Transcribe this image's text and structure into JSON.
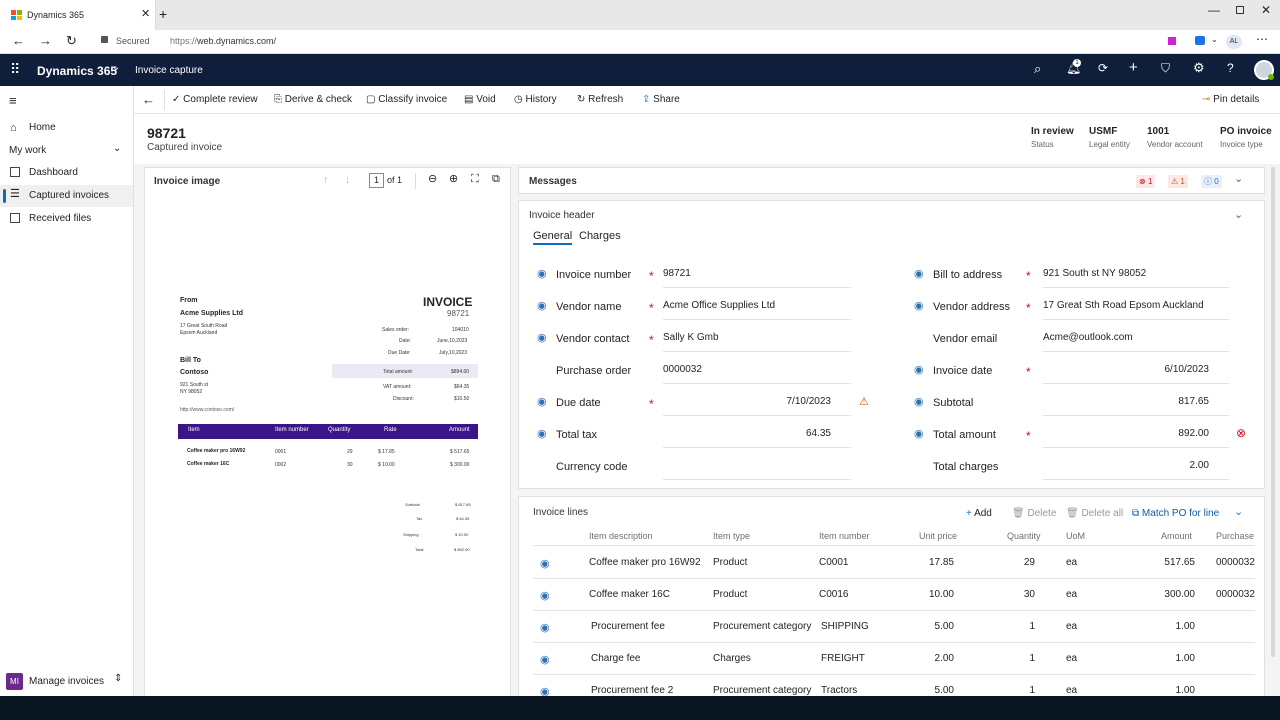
{
  "browser": {
    "tab_title": "Dynamics 365",
    "secured": "Secured",
    "url_prefix": "https://",
    "url_domain": "web.dynamics.com/",
    "avatar": "AL"
  },
  "app": {
    "name": "Dynamics 365",
    "area": "Invoice capture",
    "notif_count": "1"
  },
  "sidebar": {
    "home": "Home",
    "my_work": "My work",
    "items": [
      "Dashboard",
      "Captured invoices",
      "Received files"
    ],
    "bottom_badge": "MI",
    "bottom_label": "Manage invoices"
  },
  "cmdbar": {
    "complete": "Complete review",
    "derive": "Derive & check",
    "classify": "Classify invoice",
    "void": "Void",
    "history": "History",
    "refresh": "Refresh",
    "share": "Share",
    "pin": "Pin details"
  },
  "header": {
    "title": "98721",
    "subtitle": "Captured invoice",
    "fields": [
      {
        "value": "In review",
        "label": "Status"
      },
      {
        "value": "USMF",
        "label": "Legal entity"
      },
      {
        "value": "1001",
        "label": "Vendor account"
      },
      {
        "value": "PO invoice",
        "label": "Invoice type"
      }
    ]
  },
  "image_panel": {
    "title": "Invoice image",
    "page": "1",
    "of": "of 1"
  },
  "invoice_doc": {
    "from": "From",
    "company": "Acme Supplies Ltd",
    "addr1": "17 Great South Road",
    "addr2": "Epsom Auckland",
    "title": "INVOICE",
    "number": "98721",
    "meta": [
      {
        "k": "Sales order:",
        "v": "104010"
      },
      {
        "k": "Date:",
        "v": "June,10,2023"
      },
      {
        "k": "Due Date:",
        "v": "July,10,2023"
      }
    ],
    "bill_to": "Bill To",
    "bill_name": "Contoso",
    "bill_addr1": "921 South st",
    "bill_addr2": "NY 98052",
    "website": "http://www.contoso.com/",
    "totals": [
      {
        "k": "Total amount:",
        "v": "$894.00"
      },
      {
        "k": "VAT amount:",
        "v": "$64.35"
      },
      {
        "k": "Discount:",
        "v": "$10.50"
      }
    ],
    "cols": [
      "Item",
      "Item number",
      "Quantity",
      "Rate",
      "Amount"
    ],
    "rows": [
      [
        "Coffee maker pro 16W92",
        "0001",
        "29",
        "$ 17.85",
        "$ 517.65"
      ],
      [
        "Coffee maker 16C",
        "0002",
        "30",
        "$ 10.00",
        "$ 300.00"
      ]
    ],
    "summary": [
      {
        "k": "Subtotal",
        "v": "$ 817.65"
      },
      {
        "k": "Tax",
        "v": "$ 64.35"
      },
      {
        "k": "Shipping",
        "v": "$ 10.00"
      },
      {
        "k": "Total",
        "v": "$ 892.00"
      }
    ]
  },
  "messages": {
    "title": "Messages",
    "errors": "1",
    "warnings": "1",
    "info": "0"
  },
  "invoice_header": {
    "title": "Invoice header",
    "tabs": [
      "General",
      "Charges"
    ],
    "left": [
      {
        "label": "Invoice number",
        "value": "98721"
      },
      {
        "label": "Vendor name",
        "value": "Acme Office Supplies Ltd"
      },
      {
        "label": "Vendor contact",
        "value": "Sally K Gmb"
      },
      {
        "label": "Purchase order",
        "value": "0000032"
      },
      {
        "label": "Due date",
        "value": "7/10/2023"
      },
      {
        "label": "Total tax",
        "value": "64.35"
      },
      {
        "label": "Currency code",
        "value": ""
      }
    ],
    "right": [
      {
        "label": "Bill to address",
        "value": "921 South st NY 98052"
      },
      {
        "label": "Vendor address",
        "value": "17 Great Sth Road Epsom Auckland"
      },
      {
        "label": "Vendor email",
        "value": "Acme@outlook.com"
      },
      {
        "label": "Invoice date",
        "value": "6/10/2023"
      },
      {
        "label": "Subtotal",
        "value": "817.65"
      },
      {
        "label": "Total amount",
        "value": "892.00"
      },
      {
        "label": "Total charges",
        "value": "2.00"
      }
    ]
  },
  "invoice_lines": {
    "title": "Invoice lines",
    "add": "Add",
    "delete": "Delete",
    "delete_all": "Delete all",
    "match": "Match PO for line",
    "columns": [
      "Item description",
      "Item type",
      "Item number",
      "Unit price",
      "Quantity",
      "UoM",
      "Amount",
      "Purchase o"
    ],
    "rows": [
      [
        "Coffee maker pro 16W92",
        "Product",
        "C0001",
        "17.85",
        "29",
        "ea",
        "517.65",
        "0000032"
      ],
      [
        "Coffee maker 16C",
        "Product",
        "C0016",
        "10.00",
        "30",
        "ea",
        "300.00",
        "0000032"
      ],
      [
        "Procurement fee",
        "Procurement category",
        "SHIPPING",
        "5.00",
        "1",
        "ea",
        "1.00",
        ""
      ],
      [
        "Charge fee",
        "Charges",
        "FREIGHT",
        "2.00",
        "1",
        "ea",
        "1.00",
        ""
      ],
      [
        "Procurement fee 2",
        "Procurement category",
        "Tractors",
        "5.00",
        "1",
        "ea",
        "1.00",
        ""
      ]
    ]
  }
}
